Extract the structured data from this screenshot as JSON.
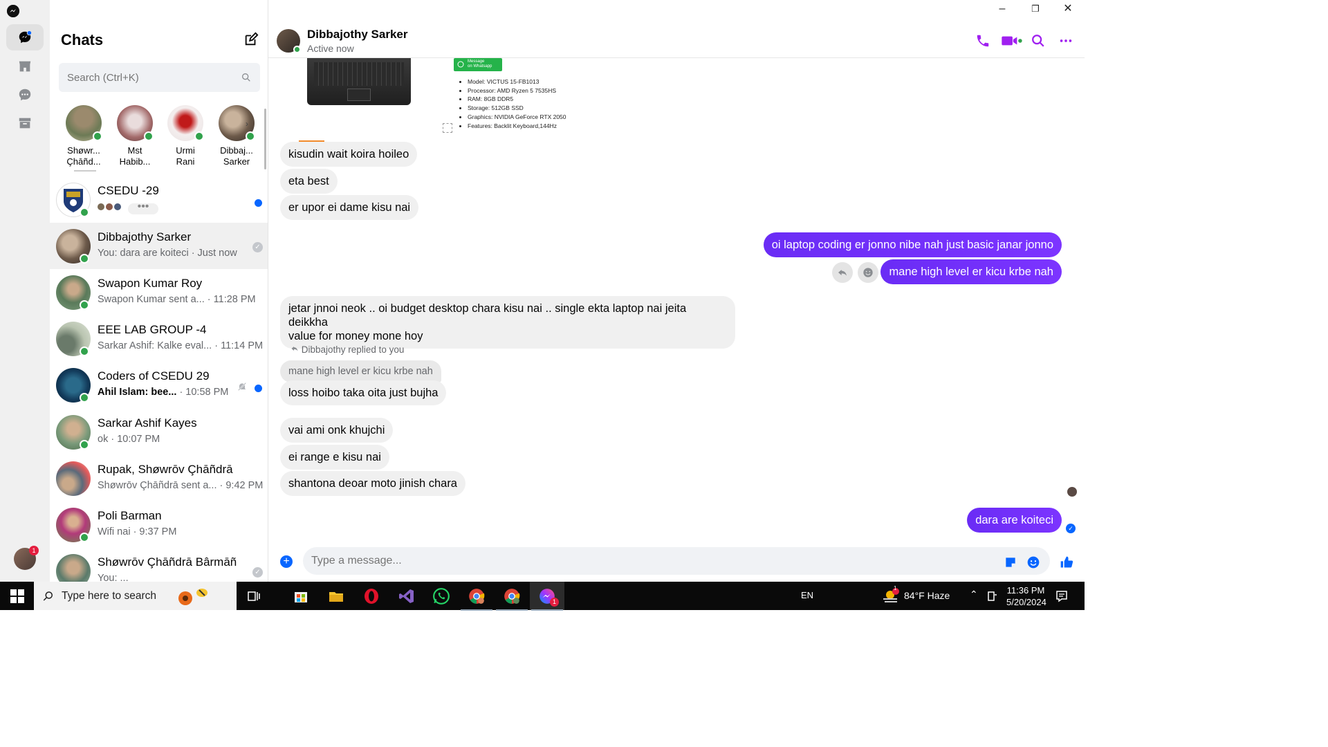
{
  "rail": {
    "items": [
      "chats",
      "marketplace",
      "requests",
      "archive"
    ],
    "profile_badge": "1"
  },
  "chats": {
    "title": "Chats",
    "search_placeholder": "Search (Ctrl+K)",
    "stories": [
      {
        "name": "Shøwr... Çhāñd...",
        "l1": "Shøwr...",
        "l2": "Çhāñd..."
      },
      {
        "name": "Mst Habib...",
        "l1": "Mst",
        "l2": "Habib..."
      },
      {
        "name": "Urmi Rani",
        "l1": "Urmi",
        "l2": "Rani"
      },
      {
        "name": "Dibbaj... Sarker",
        "l1": "Dibbaj...",
        "l2": "Sarker"
      }
    ],
    "list": [
      {
        "title": "CSEDU -29",
        "sub": "",
        "time": "",
        "unread": true
      },
      {
        "title": "Dibbajothy Sarker",
        "sub": "You: dara are koiteci · Just now",
        "selected": true
      },
      {
        "title": "Swapon Kumar Roy",
        "sub": "Swapon Kumar sent a...",
        "time": " · 11:28 PM"
      },
      {
        "title": "EEE LAB GROUP -4",
        "sub": "Sarkar Ashif: Kalke eval...",
        "time": " · 11:14 PM"
      },
      {
        "title": "Coders of CSEDU 29",
        "sub": "Ahil Islam: bee...",
        "time": " · 10:58 PM",
        "unread": true,
        "muted": true
      },
      {
        "title": "Sarkar Ashif Kayes",
        "sub": "ok · 10:07 PM"
      },
      {
        "title": "Rupak, Shøwrōv Çhāñdrā",
        "sub": "Shøwrōv Çhāñdrā sent a...",
        "time": " · 9:42 PM"
      },
      {
        "title": "Poli Barman",
        "sub": "Wifi nai · 9:37 PM"
      },
      {
        "title": "Shøwrōv Çhāñdrā Bârmāñ",
        "sub": "You: ..."
      }
    ]
  },
  "conversation": {
    "name": "Dibbajothy Sarker",
    "status": "Active now",
    "whatsapp_label_1": "Message",
    "whatsapp_label_2": "on Whatsapp",
    "specs": [
      "Model: VICTUS 15-FB1013",
      "Processor: AMD Ryzen 5 7535HS",
      "RAM: 8GB DDR5",
      "Storage: 512GB SSD",
      "Graphics: NVIDIA GeForce RTX 2050",
      "Features: Backlit Keyboard,144Hz"
    ],
    "messages": {
      "m1": "kisudin wait koira hoileo",
      "m2": "eta best",
      "m3": "er upor ei dame kisu nai",
      "m4": "oi laptop coding er jonno nibe nah just basic janar jonno",
      "m5": "mane high level er kicu krbe nah",
      "m6a": "jetar jnnoi neok .. oi  budget desktop chara kisu nai .. single ekta laptop nai jeita deikkha",
      "m6b": "value for money mone hoy",
      "reply_tag": "Dibbajothy replied to you",
      "quoted": "mane high level er kicu krbe nah",
      "m7": "loss hoibo taka oita just bujha",
      "m8": "vai ami onk khujchi",
      "m9": "ei range e kisu nai",
      "m10": "shantona deoar moto jinish chara",
      "m11": "dara are koiteci"
    },
    "composer_placeholder": "Type a message..."
  },
  "taskbar": {
    "search": "Type here to search",
    "lang": "EN",
    "weather": "84°F  Haze",
    "weather_badge": "1",
    "time": "11:36 PM",
    "date": "5/20/2024",
    "messenger_badge": "1"
  }
}
